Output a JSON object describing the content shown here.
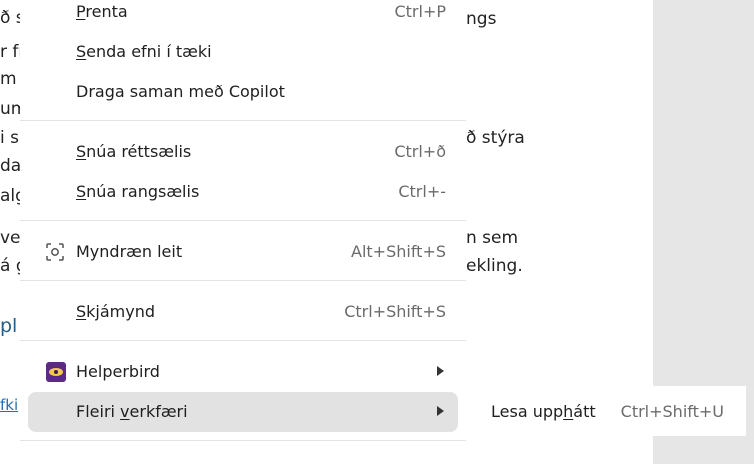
{
  "background_text": {
    "left_fragments": [
      "ð s",
      "r fr",
      "m",
      "um",
      "i sa",
      "da",
      "alg",
      "ve",
      "á g"
    ],
    "right_fragments": [
      "ngs",
      "ð stýra",
      "n sem",
      "ekling."
    ],
    "blue_fragment": "pl",
    "link_fragment": "fki"
  },
  "menu": {
    "items": [
      {
        "mnemonic": "P",
        "rest": "renta",
        "shortcut": "Ctrl+P"
      },
      {
        "mnemonic": "S",
        "rest": "enda efni í tæki",
        "shortcut": ""
      },
      {
        "mnemonic": "",
        "rest": "Draga saman með Copilot",
        "shortcut": ""
      },
      {
        "mnemonic": "S",
        "rest": "núa réttsælis",
        "shortcut": "Ctrl+ð"
      },
      {
        "mnemonic": "S",
        "rest": "núa rangsælis",
        "shortcut": "Ctrl+-"
      },
      {
        "mnemonic": "",
        "rest": "Myndræn leit",
        "shortcut": "Alt+Shift+S"
      },
      {
        "mnemonic": "S",
        "rest": "kjámynd",
        "shortcut": "Ctrl+Shift+S"
      },
      {
        "mnemonic": "",
        "rest": "Helperbird",
        "shortcut": ""
      },
      {
        "label_before": "Fleiri ",
        "mnemonic": "v",
        "label_after": "erkfæri",
        "shortcut": ""
      }
    ]
  },
  "submenu": {
    "label_before": "Lesa upp",
    "mnemonic": "h",
    "label_after": "átt",
    "shortcut": "Ctrl+Shift+U"
  },
  "icons": {
    "visual_search": "visual-search-icon",
    "helperbird": "helperbird-icon",
    "submenu_arrow": "chevron-right-icon"
  },
  "colors": {
    "highlight": "#e2e2e2",
    "helperbird_purple": "#5b2a86",
    "doc_blue": "#1f5f8b"
  }
}
